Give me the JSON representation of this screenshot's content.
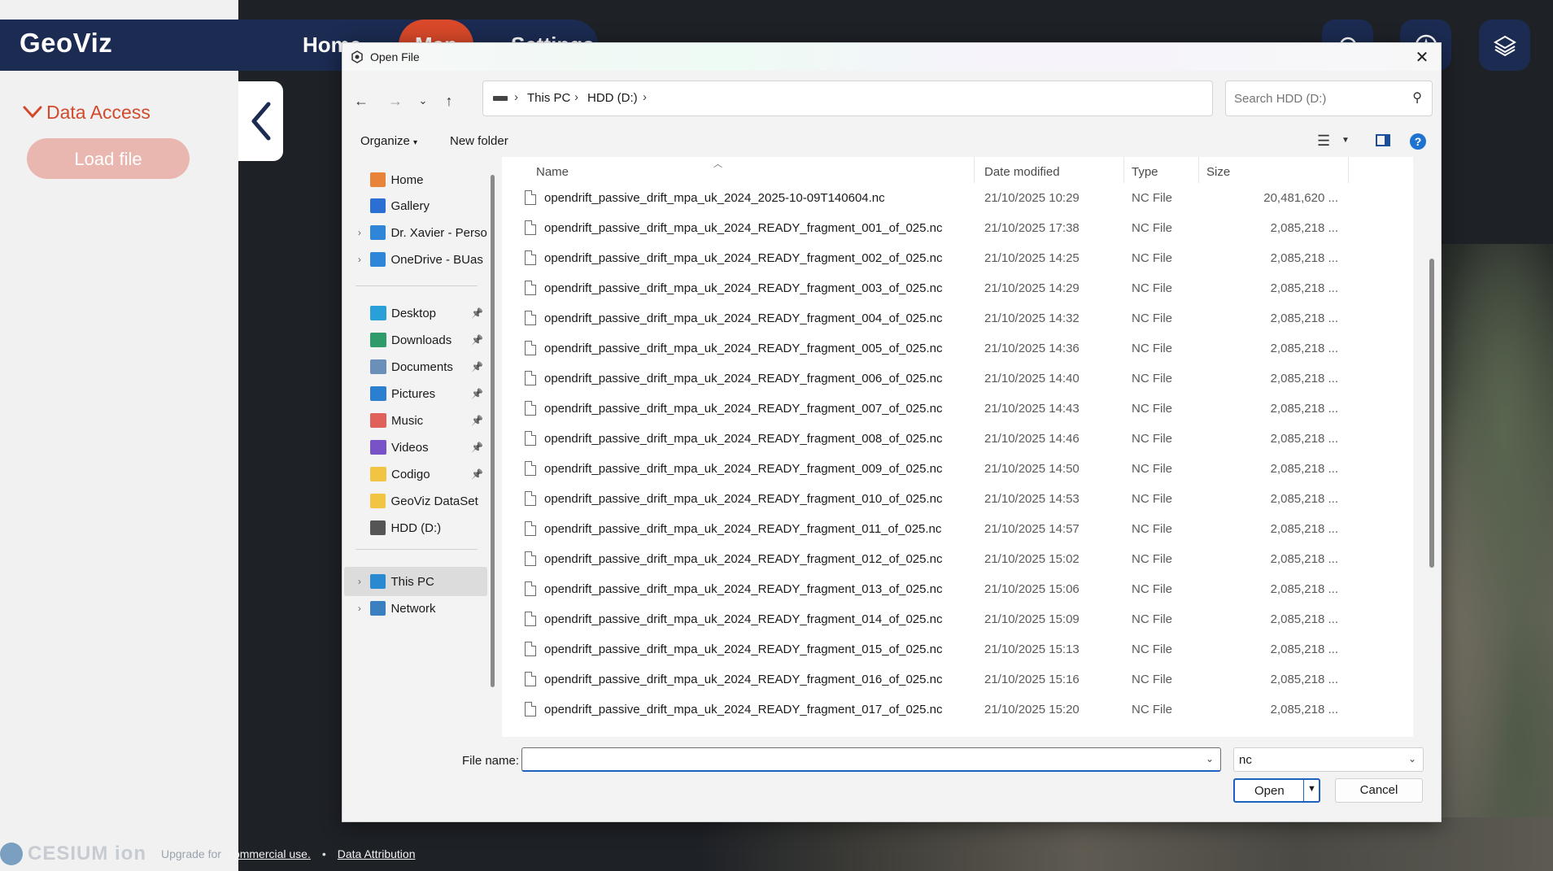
{
  "app": {
    "brand": "GeoViz",
    "nav": {
      "home": "Home",
      "map": "Map",
      "settings": "Settings"
    },
    "sidebar": {
      "section_title": "Data Access",
      "load_button": "Load file"
    },
    "footer": {
      "logo_text": "CESIUM ion",
      "upgrade_prefix": "Upgrade for",
      "upgrade_link": "commercial use.",
      "separator": "•",
      "attribution_link": "Data Attribution"
    },
    "colors": {
      "header": "#1b2b52",
      "accent": "#d9492a",
      "load_button": "#eab7b0"
    }
  },
  "dialog": {
    "title": "Open File",
    "address": {
      "crumbs": [
        "This PC",
        "HDD (D:)"
      ]
    },
    "search_placeholder": "Search HDD (D:)",
    "toolbar": {
      "organize": "Organize",
      "new_folder": "New folder"
    },
    "nav_pane": [
      {
        "label": "Home",
        "icon": "home-icon",
        "color": "#e8833a",
        "expand": false,
        "pin": false
      },
      {
        "label": "Gallery",
        "icon": "gallery-icon",
        "color": "#2a6fd1",
        "expand": false,
        "pin": false
      },
      {
        "label": "Dr. Xavier - Personal",
        "icon": "onedrive-icon",
        "color": "#2f86d8",
        "expand": true,
        "pin": false
      },
      {
        "label": "OneDrive - BUas",
        "icon": "onedrive-icon",
        "color": "#2f86d8",
        "expand": true,
        "pin": false
      },
      {
        "label": "Desktop",
        "icon": "desktop-icon",
        "color": "#2aa0d8",
        "expand": false,
        "pin": true
      },
      {
        "label": "Downloads",
        "icon": "downloads-icon",
        "color": "#2f9a6a",
        "expand": false,
        "pin": true
      },
      {
        "label": "Documents",
        "icon": "documents-icon",
        "color": "#6a8fb8",
        "expand": false,
        "pin": true
      },
      {
        "label": "Pictures",
        "icon": "pictures-icon",
        "color": "#2a7fd1",
        "expand": false,
        "pin": true
      },
      {
        "label": "Music",
        "icon": "music-icon",
        "color": "#e0605a",
        "expand": false,
        "pin": true
      },
      {
        "label": "Videos",
        "icon": "videos-icon",
        "color": "#7a52c8",
        "expand": false,
        "pin": true
      },
      {
        "label": "Codigo",
        "icon": "folder-icon",
        "color": "#f2c443",
        "expand": false,
        "pin": true
      },
      {
        "label": "GeoViz DataSet",
        "icon": "folder-icon",
        "color": "#f2c443",
        "expand": false,
        "pin": false
      },
      {
        "label": "HDD (D:)",
        "icon": "drive-icon",
        "color": "#555555",
        "expand": false,
        "pin": false
      },
      {
        "label": "This PC",
        "icon": "pc-icon",
        "color": "#2a8ad1",
        "expand": true,
        "pin": false
      },
      {
        "label": "Network",
        "icon": "network-icon",
        "color": "#3a7fc0",
        "expand": true,
        "pin": false
      }
    ],
    "columns": {
      "name": "Name",
      "date": "Date modified",
      "type": "Type",
      "size": "Size"
    },
    "files": [
      {
        "name": "opendrift_passive_drift_mpa_uk_2024_2025-10-09T140604.nc",
        "date": "21/10/2025 10:29",
        "type": "NC File",
        "size": "20,481,620 ..."
      },
      {
        "name": "opendrift_passive_drift_mpa_uk_2024_READY_fragment_001_of_025.nc",
        "date": "21/10/2025 17:38",
        "type": "NC File",
        "size": "2,085,218 ..."
      },
      {
        "name": "opendrift_passive_drift_mpa_uk_2024_READY_fragment_002_of_025.nc",
        "date": "21/10/2025 14:25",
        "type": "NC File",
        "size": "2,085,218 ..."
      },
      {
        "name": "opendrift_passive_drift_mpa_uk_2024_READY_fragment_003_of_025.nc",
        "date": "21/10/2025 14:29",
        "type": "NC File",
        "size": "2,085,218 ..."
      },
      {
        "name": "opendrift_passive_drift_mpa_uk_2024_READY_fragment_004_of_025.nc",
        "date": "21/10/2025 14:32",
        "type": "NC File",
        "size": "2,085,218 ..."
      },
      {
        "name": "opendrift_passive_drift_mpa_uk_2024_READY_fragment_005_of_025.nc",
        "date": "21/10/2025 14:36",
        "type": "NC File",
        "size": "2,085,218 ..."
      },
      {
        "name": "opendrift_passive_drift_mpa_uk_2024_READY_fragment_006_of_025.nc",
        "date": "21/10/2025 14:40",
        "type": "NC File",
        "size": "2,085,218 ..."
      },
      {
        "name": "opendrift_passive_drift_mpa_uk_2024_READY_fragment_007_of_025.nc",
        "date": "21/10/2025 14:43",
        "type": "NC File",
        "size": "2,085,218 ..."
      },
      {
        "name": "opendrift_passive_drift_mpa_uk_2024_READY_fragment_008_of_025.nc",
        "date": "21/10/2025 14:46",
        "type": "NC File",
        "size": "2,085,218 ..."
      },
      {
        "name": "opendrift_passive_drift_mpa_uk_2024_READY_fragment_009_of_025.nc",
        "date": "21/10/2025 14:50",
        "type": "NC File",
        "size": "2,085,218 ..."
      },
      {
        "name": "opendrift_passive_drift_mpa_uk_2024_READY_fragment_010_of_025.nc",
        "date": "21/10/2025 14:53",
        "type": "NC File",
        "size": "2,085,218 ..."
      },
      {
        "name": "opendrift_passive_drift_mpa_uk_2024_READY_fragment_011_of_025.nc",
        "date": "21/10/2025 14:57",
        "type": "NC File",
        "size": "2,085,218 ..."
      },
      {
        "name": "opendrift_passive_drift_mpa_uk_2024_READY_fragment_012_of_025.nc",
        "date": "21/10/2025 15:02",
        "type": "NC File",
        "size": "2,085,218 ..."
      },
      {
        "name": "opendrift_passive_drift_mpa_uk_2024_READY_fragment_013_of_025.nc",
        "date": "21/10/2025 15:06",
        "type": "NC File",
        "size": "2,085,218 ..."
      },
      {
        "name": "opendrift_passive_drift_mpa_uk_2024_READY_fragment_014_of_025.nc",
        "date": "21/10/2025 15:09",
        "type": "NC File",
        "size": "2,085,218 ..."
      },
      {
        "name": "opendrift_passive_drift_mpa_uk_2024_READY_fragment_015_of_025.nc",
        "date": "21/10/2025 15:13",
        "type": "NC File",
        "size": "2,085,218 ..."
      },
      {
        "name": "opendrift_passive_drift_mpa_uk_2024_READY_fragment_016_of_025.nc",
        "date": "21/10/2025 15:16",
        "type": "NC File",
        "size": "2,085,218 ..."
      },
      {
        "name": "opendrift_passive_drift_mpa_uk_2024_READY_fragment_017_of_025.nc",
        "date": "21/10/2025 15:20",
        "type": "NC File",
        "size": "2,085,218 ..."
      }
    ],
    "file_name_label": "File name:",
    "file_name_value": "",
    "file_type_value": "nc",
    "open_button": "Open",
    "cancel_button": "Cancel"
  }
}
